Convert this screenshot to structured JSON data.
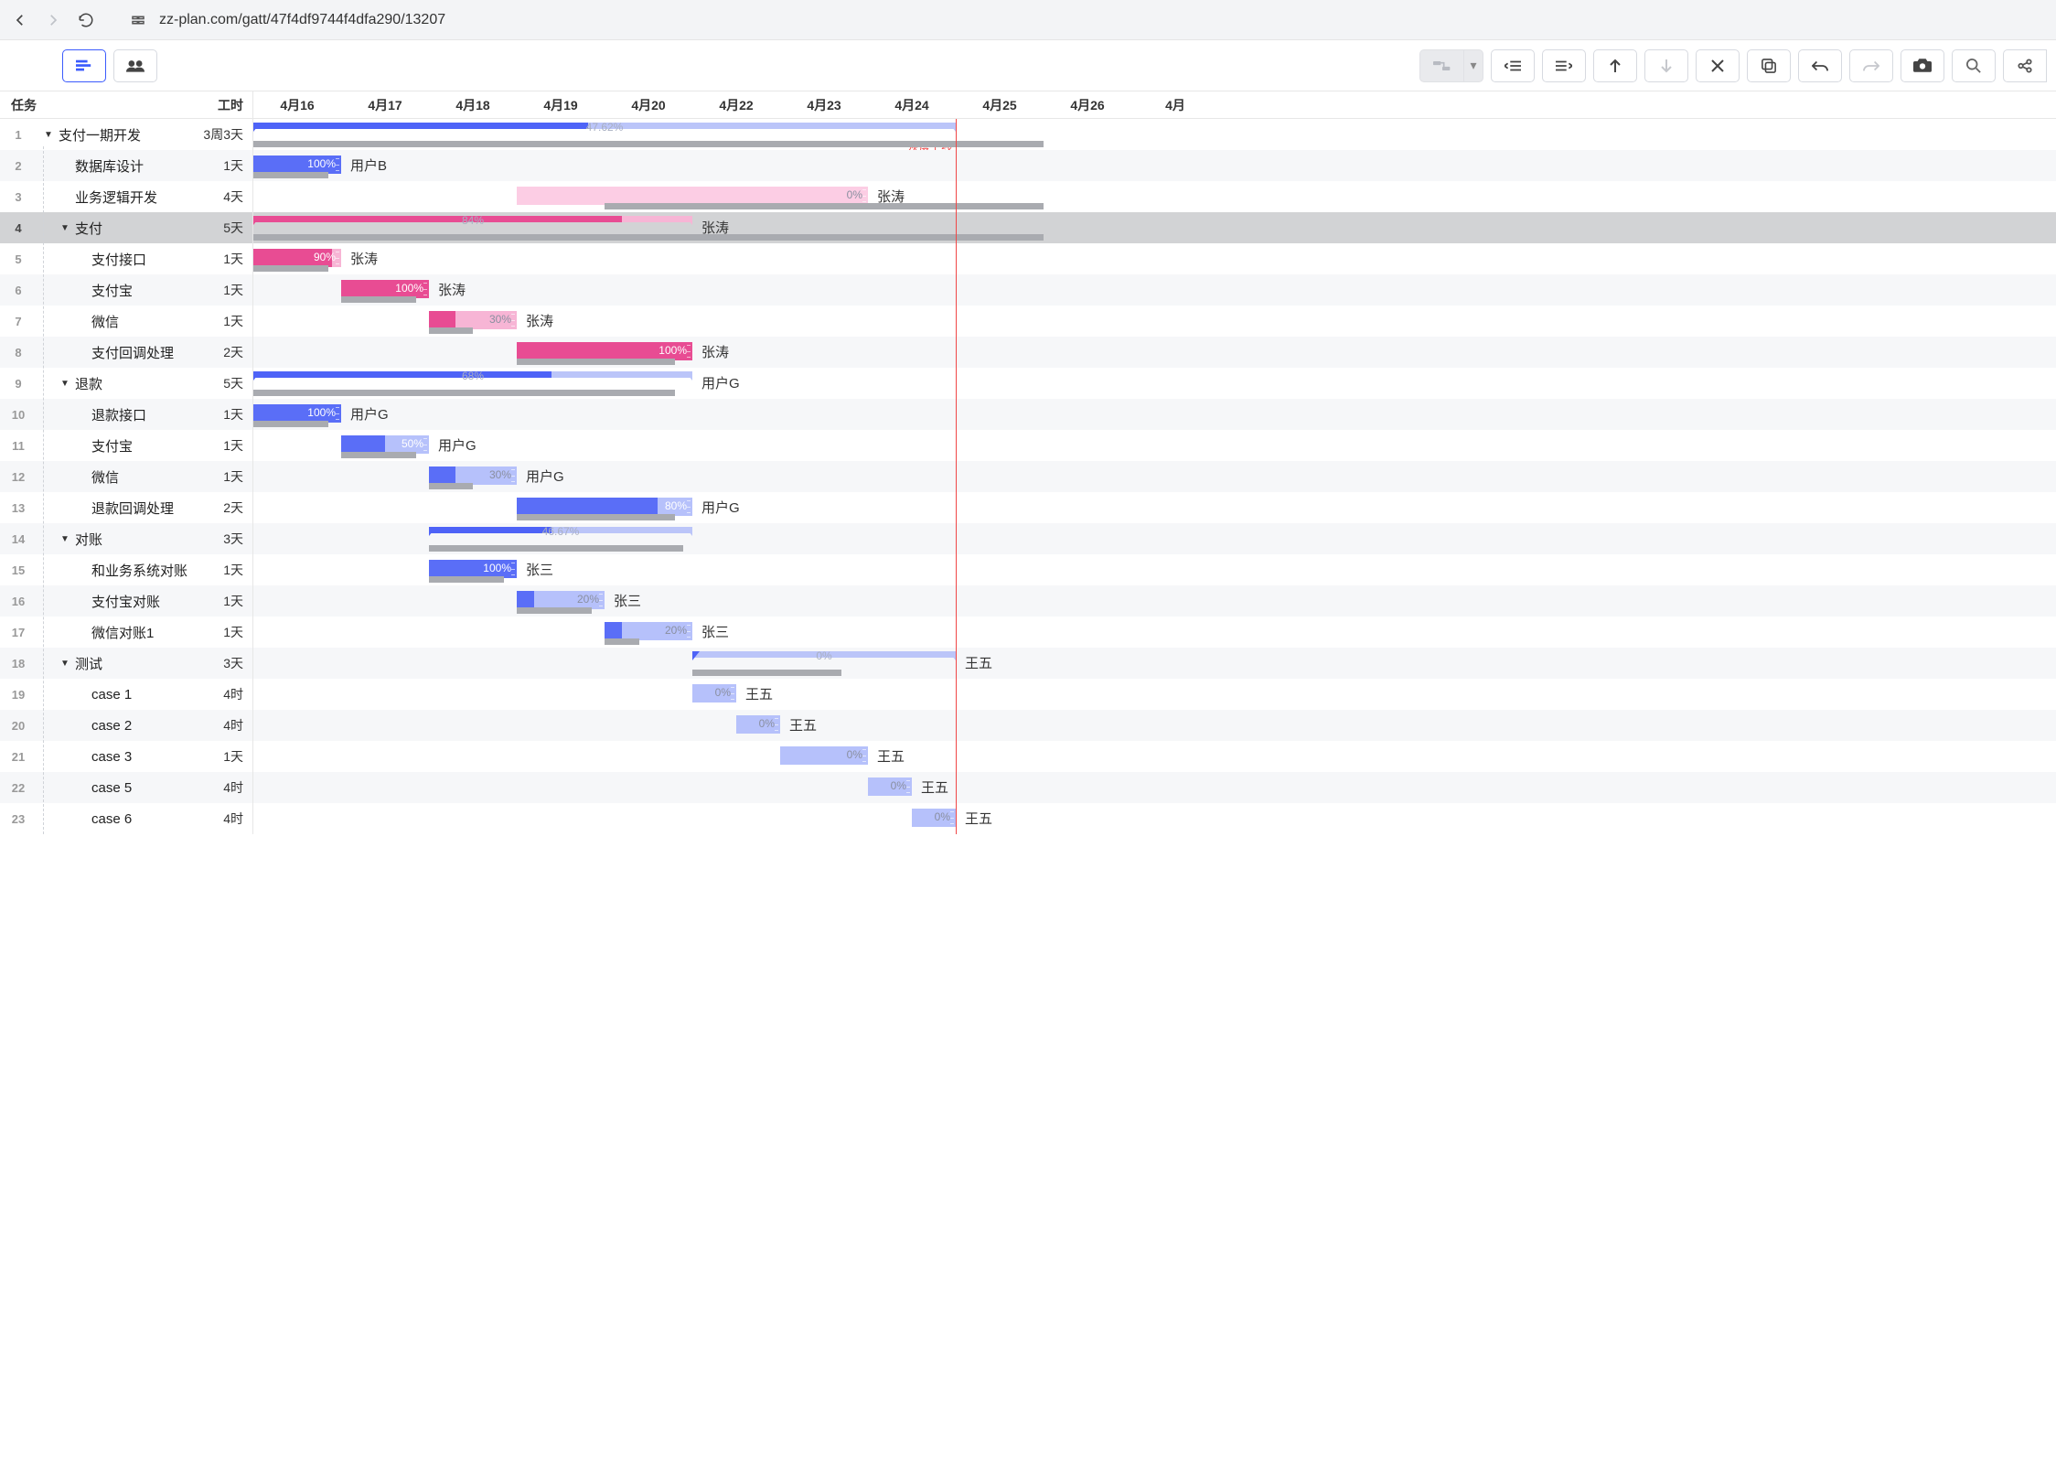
{
  "url": "zz-plan.com/gatt/47f4df9744f4dfa290/13207",
  "headers": {
    "task": "任务",
    "duration": "工时"
  },
  "milestone": {
    "label": "灰度上线",
    "day_offset": 8.0
  },
  "timeline": [
    "4月16",
    "4月17",
    "4月18",
    "4月19",
    "4月20",
    "4月22",
    "4月23",
    "4月24",
    "4月25",
    "4月26",
    "4月"
  ],
  "day_width": 96,
  "rows": [
    {
      "idx": 1,
      "level": 0,
      "name": "支付一期开发",
      "duration": "3周3天",
      "type": "summary",
      "start": 0,
      "end": 8.0,
      "progress": 47.62,
      "pct": "47.62%",
      "color": "#4e63f7",
      "bg": "#bbc5f9",
      "baseline": [
        0,
        9.0
      ]
    },
    {
      "idx": 2,
      "level": 1,
      "name": "数据库设计",
      "duration": "1天",
      "type": "task",
      "start": 0,
      "end": 1,
      "progress": 100,
      "pct": "100%",
      "color": "#5a6ef7",
      "bg": "#b6c1fb",
      "assignee": "用户B",
      "baseline": [
        0,
        0.85
      ]
    },
    {
      "idx": 3,
      "level": 1,
      "name": "业务逻辑开发",
      "duration": "4天",
      "type": "task",
      "start": 3,
      "end": 7,
      "progress": 0,
      "pct": "0%",
      "color": "#f49ac1",
      "bg": "#fccde4",
      "assignee": "张涛",
      "baseline": [
        4,
        9.0
      ]
    },
    {
      "idx": 4,
      "level": 1,
      "name": "支付",
      "duration": "5天",
      "type": "summary",
      "start": 0,
      "end": 5,
      "progress": 84,
      "pct": "84%",
      "color": "#e84c93",
      "bg": "#f7b5d5",
      "assignee": "张涛",
      "baseline": [
        0,
        9.0
      ]
    },
    {
      "idx": 5,
      "level": 2,
      "name": "支付接口",
      "duration": "1天",
      "type": "task",
      "start": 0,
      "end": 1,
      "progress": 90,
      "pct": "90%",
      "color": "#e84c93",
      "bg": "#f7b5d5",
      "assignee": "张涛",
      "baseline": [
        0,
        0.85
      ]
    },
    {
      "idx": 6,
      "level": 2,
      "name": "支付宝",
      "duration": "1天",
      "type": "task",
      "start": 1,
      "end": 2,
      "progress": 100,
      "pct": "100%",
      "color": "#e84c93",
      "bg": "#f7b5d5",
      "assignee": "张涛",
      "baseline": [
        1,
        1.85
      ]
    },
    {
      "idx": 7,
      "level": 2,
      "name": "微信",
      "duration": "1天",
      "type": "task",
      "start": 2,
      "end": 3,
      "progress": 30,
      "pct": "30%",
      "color": "#e84c93",
      "bg": "#f7b5d5",
      "assignee": "张涛",
      "baseline": [
        2,
        2.5
      ]
    },
    {
      "idx": 8,
      "level": 2,
      "name": "支付回调处理",
      "duration": "2天",
      "type": "task",
      "start": 3,
      "end": 5,
      "progress": 100,
      "pct": "100%",
      "color": "#e84c93",
      "bg": "#f7b5d5",
      "assignee": "张涛",
      "baseline": [
        3,
        4.8
      ]
    },
    {
      "idx": 9,
      "level": 1,
      "name": "退款",
      "duration": "5天",
      "type": "summary",
      "start": 0,
      "end": 5,
      "progress": 68,
      "pct": "68%",
      "color": "#4e63f7",
      "bg": "#bbc5f9",
      "assignee": "用户G",
      "baseline": [
        0,
        4.8
      ]
    },
    {
      "idx": 10,
      "level": 2,
      "name": "退款接口",
      "duration": "1天",
      "type": "task",
      "start": 0,
      "end": 1,
      "progress": 100,
      "pct": "100%",
      "color": "#5a6ef7",
      "bg": "#b6c1fb",
      "assignee": "用户G",
      "baseline": [
        0,
        0.85
      ]
    },
    {
      "idx": 11,
      "level": 2,
      "name": "支付宝",
      "duration": "1天",
      "type": "task",
      "start": 1,
      "end": 2,
      "progress": 50,
      "pct": "50%",
      "color": "#5a6ef7",
      "bg": "#b6c1fb",
      "assignee": "用户G",
      "baseline": [
        1,
        1.85
      ]
    },
    {
      "idx": 12,
      "level": 2,
      "name": "微信",
      "duration": "1天",
      "type": "task",
      "start": 2,
      "end": 3,
      "progress": 30,
      "pct": "30%",
      "color": "#5a6ef7",
      "bg": "#b6c1fb",
      "assignee": "用户G",
      "baseline": [
        2,
        2.5
      ]
    },
    {
      "idx": 13,
      "level": 2,
      "name": "退款回调处理",
      "duration": "2天",
      "type": "task",
      "start": 3,
      "end": 5,
      "progress": 80,
      "pct": "80%",
      "color": "#5a6ef7",
      "bg": "#b6c1fb",
      "assignee": "用户G",
      "baseline": [
        3,
        4.8
      ]
    },
    {
      "idx": 14,
      "level": 1,
      "name": "对账",
      "duration": "3天",
      "type": "summary",
      "start": 2,
      "end": 5,
      "progress": 46.67,
      "pct": "46.67%",
      "color": "#4e63f7",
      "bg": "#bbc5f9",
      "baseline": [
        2,
        4.9
      ]
    },
    {
      "idx": 15,
      "level": 2,
      "name": "和业务系统对账",
      "duration": "1天",
      "type": "task",
      "start": 2,
      "end": 3,
      "progress": 100,
      "pct": "100%",
      "color": "#5a6ef7",
      "bg": "#b6c1fb",
      "assignee": "张三",
      "baseline": [
        2,
        2.85
      ]
    },
    {
      "idx": 16,
      "level": 2,
      "name": "支付宝对账",
      "duration": "1天",
      "type": "task",
      "start": 3,
      "end": 4,
      "progress": 20,
      "pct": "20%",
      "color": "#5a6ef7",
      "bg": "#b6c1fb",
      "assignee": "张三",
      "baseline": [
        3,
        3.85
      ]
    },
    {
      "idx": 17,
      "level": 2,
      "name": "微信对账1",
      "duration": "1天",
      "type": "task",
      "start": 4,
      "end": 5,
      "progress": 20,
      "pct": "20%",
      "color": "#5a6ef7",
      "bg": "#b6c1fb",
      "assignee": "张三",
      "baseline": [
        4,
        4.4
      ]
    },
    {
      "idx": 18,
      "level": 1,
      "name": "测试",
      "duration": "3天",
      "type": "summary",
      "start": 5,
      "end": 8.0,
      "progress": 0,
      "pct": "0%",
      "color": "#4e63f7",
      "bg": "#bbc5f9",
      "assignee": "王五",
      "baseline": [
        5,
        6.7
      ]
    },
    {
      "idx": 19,
      "level": 2,
      "name": "case 1",
      "duration": "4时",
      "type": "task",
      "start": 5,
      "end": 5.5,
      "progress": 0,
      "pct": "0%",
      "color": "#5a6ef7",
      "bg": "#b6c1fb",
      "assignee": "王五"
    },
    {
      "idx": 20,
      "level": 2,
      "name": "case 2",
      "duration": "4时",
      "type": "task",
      "start": 5.5,
      "end": 6,
      "progress": 0,
      "pct": "0%",
      "color": "#5a6ef7",
      "bg": "#b6c1fb",
      "assignee": "王五"
    },
    {
      "idx": 21,
      "level": 2,
      "name": "case 3",
      "duration": "1天",
      "type": "task",
      "start": 6,
      "end": 7,
      "progress": 0,
      "pct": "0%",
      "color": "#5a6ef7",
      "bg": "#b6c1fb",
      "assignee": "王五"
    },
    {
      "idx": 22,
      "level": 2,
      "name": "case 5",
      "duration": "4时",
      "type": "task",
      "start": 7,
      "end": 7.5,
      "progress": 0,
      "pct": "0%",
      "color": "#5a6ef7",
      "bg": "#b6c1fb",
      "assignee": "王五"
    },
    {
      "idx": 23,
      "level": 2,
      "name": "case 6",
      "duration": "4时",
      "type": "task",
      "start": 7.5,
      "end": 8.0,
      "progress": 0,
      "pct": "0%",
      "color": "#5a6ef7",
      "bg": "#b6c1fb",
      "assignee": "王五"
    }
  ],
  "active_row": 4
}
